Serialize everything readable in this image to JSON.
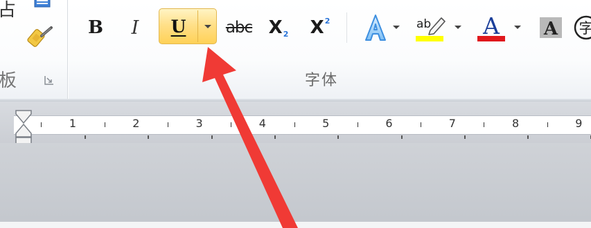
{
  "clipboard": {
    "paste_char": "占",
    "group_label": "板"
  },
  "font_group": {
    "label": "字体",
    "bold_label": "B",
    "italic_label": "I",
    "underline_label": "U",
    "strike_label": "abc",
    "subscript_label": "X",
    "subscript_mark": "2",
    "superscript_label": "X",
    "superscript_mark": "2",
    "highlight_label": "ab",
    "font_color_label": "A",
    "shading_label": "A",
    "border_label": "字"
  },
  "ruler": {
    "labels": [
      "1",
      "2",
      "3",
      "4",
      "5",
      "6",
      "7",
      "8",
      "9"
    ]
  },
  "colors": {
    "highlight": "#ffff00",
    "font_color": "#e0181d",
    "active_button": "#ffe08a",
    "annotation_arrow": "#f03a35"
  },
  "icons": {
    "copy": "copy-icon",
    "format_painter": "format-painter-icon",
    "text_effects": "text-effects-icon",
    "highlight": "highlight-icon",
    "font_color": "font-color-icon",
    "shading": "character-shading-icon",
    "border": "enclosed-character-icon"
  }
}
